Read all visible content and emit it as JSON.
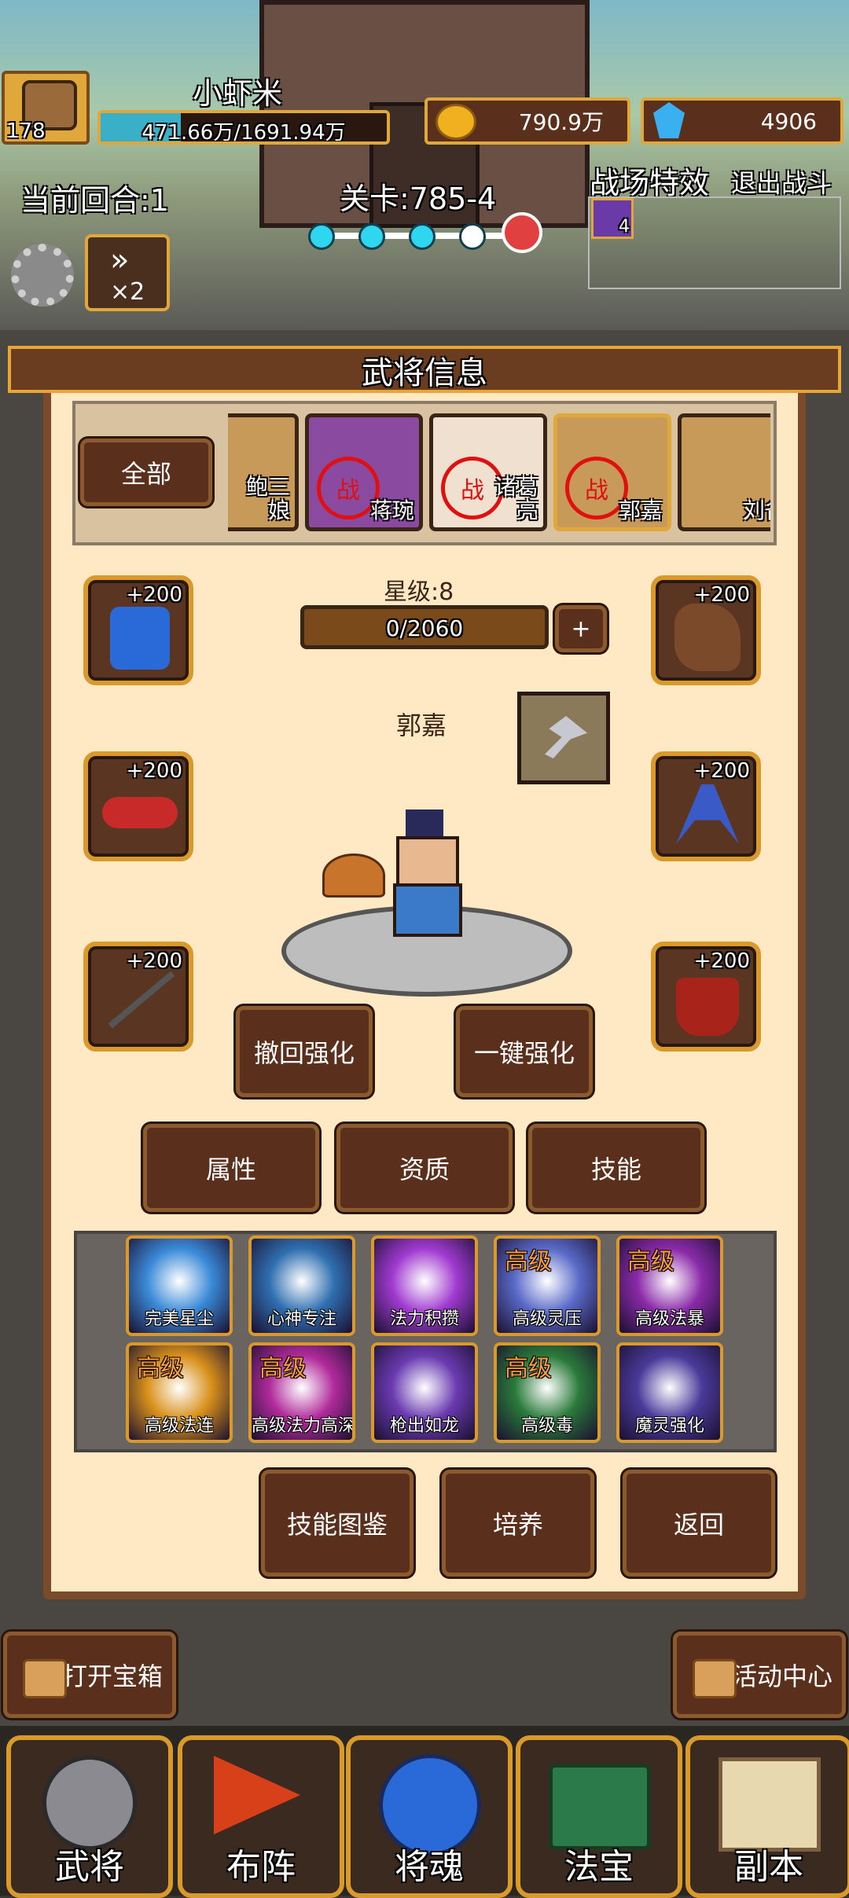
{
  "player": {
    "level": "178",
    "name": "小虾米",
    "hp": "471.66万/1691.94万"
  },
  "currency": {
    "gold": "790.9万",
    "gems": "4906"
  },
  "battle": {
    "round": "当前回合:1",
    "stage": "关卡:785-4",
    "field_effects": "战场特效",
    "exit": "退出战斗",
    "effect_count": "4",
    "speed": "×2"
  },
  "panel": {
    "title": "武将信息",
    "filter_all": "全部",
    "heroes": [
      {
        "name": "鲍三\n娘",
        "in_battle": false
      },
      {
        "name": "蒋琬",
        "in_battle": true
      },
      {
        "name": "诸葛\n亮",
        "in_battle": true
      },
      {
        "name": "郭嘉",
        "in_battle": true
      },
      {
        "name": "刘备",
        "in_battle": false
      }
    ],
    "battle_mark": "战",
    "star_label": "星级:8",
    "exp": "0/2060",
    "add": "+",
    "hero_name": "郭嘉",
    "equip_bonus": "+200",
    "btn_revert": "撤回强化",
    "btn_one_key": "一键强化",
    "tabs": [
      "属性",
      "资质",
      "技能"
    ],
    "skills": [
      {
        "name": "完美星尘",
        "adv": "",
        "color": "#3a8ad8"
      },
      {
        "name": "心神专注",
        "adv": "",
        "color": "#2f6fb0"
      },
      {
        "name": "法力积攒",
        "adv": "",
        "color": "#a03ad0"
      },
      {
        "name": "高级灵压",
        "adv": "高级",
        "color": "#5a6ac8"
      },
      {
        "name": "高级法暴",
        "adv": "高级",
        "color": "#8a2aa8"
      },
      {
        "name": "高级法连",
        "adv": "高级",
        "color": "#d8901a"
      },
      {
        "name": "高级法力高深",
        "adv": "高级",
        "color": "#b02a9a"
      },
      {
        "name": "枪出如龙",
        "adv": "",
        "color": "#6a3ab0"
      },
      {
        "name": "高级毒",
        "adv": "高级",
        "color": "#2a7a3a"
      },
      {
        "name": "魔灵强化",
        "adv": "",
        "color": "#4a3a9a"
      }
    ],
    "btn_skill_book": "技能图鉴",
    "btn_train": "培养",
    "btn_back": "返回"
  },
  "side": {
    "open_chest": "打开宝箱",
    "event_center": "活动中心"
  },
  "nav": [
    "武将",
    "布阵",
    "将魂",
    "法宝",
    "副本"
  ]
}
